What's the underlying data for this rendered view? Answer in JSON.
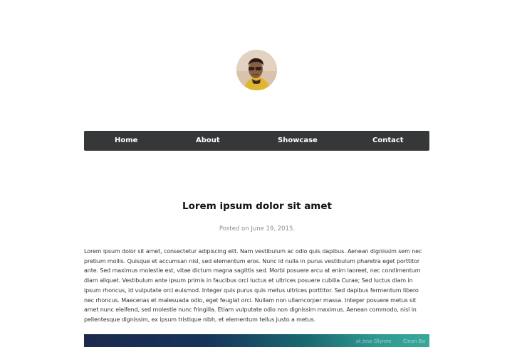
{
  "nav": {
    "items": [
      {
        "label": "Home"
      },
      {
        "label": "About"
      },
      {
        "label": "Showcase"
      },
      {
        "label": "Contact"
      }
    ]
  },
  "post": {
    "title": "Lorem ipsum dolor sit amet",
    "meta_prefix": "Posted on",
    "date": "June 19, 2015.",
    "body": "Lorem ipsum dolor sit amet, consectetur adipiscing elit. Nam vestibulum ac odio quis dapibus. Aenean dignissim sem nec pretium mollis. Quisque et accumsan nisl, sed elementum eros. Nunc id nulla in purus vestibulum pharetra eget porttitor ante. Sed maximus molestie est, vitae dictum magna sagittis sed. Morbi posuere arcu at enim laoreet, nec condimentum diam aliquet. Vestibulum ante ipsum primis in faucibus orci luctus et ultrices posuere cubilia Curae; Sed luctus diam in ipsum rhoncus, id vulputate orci euismod. Integer quis purus quis metus ultrices porttitor. Sed dapibus fermentum libero nec rhoncus. Maecenas et malesuada odio, eget feugiat orci. Nullam non ullamcorper massa. Integer posuere metus sit amet nunc eleifend, sed molestie nunc fringilla. Etiam vulputate odio non dignissim maximus. Aenean commodo, nisl in pellentesque dignissim, ex ipsum tristique nibh, et elementum tellus justo a metus."
  },
  "banner": {
    "caption_1": "at Jess Glynne",
    "caption_2": "Clean Ba"
  },
  "colors": {
    "nav_background": "#353739",
    "nav_text": "#ffffff",
    "title": "#111111",
    "meta": "#8c8c8c",
    "body_text": "#333333"
  }
}
